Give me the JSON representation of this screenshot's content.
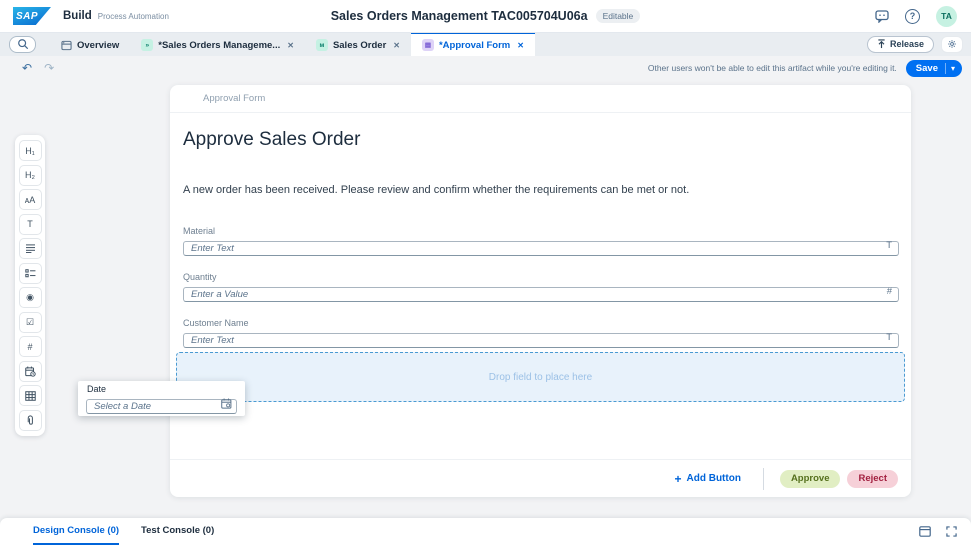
{
  "header": {
    "logo": "SAP",
    "product": "Build",
    "product_tagline": "Process Automation",
    "title": "Sales Orders Management TAC005704U06a",
    "editable_badge": "Editable",
    "help_glyph": "?",
    "avatar": "TA"
  },
  "tab_strip": {
    "tabs": [
      {
        "label": "Overview"
      },
      {
        "label": "*Sales Orders Manageme...",
        "glyph": "»"
      },
      {
        "label": "Sales Order",
        "glyph": "ᴍ"
      },
      {
        "label": "*Approval Form",
        "glyph": "▤"
      }
    ],
    "release_label": "Release"
  },
  "toolbar": {
    "lock_message": "Other users won't be able to edit this artifact while you're editing it.",
    "save_label": "Save"
  },
  "palette": {
    "glyphs": {
      "heading1": "H₁",
      "heading2": "H₂",
      "font": "ᴀA",
      "text": "T",
      "radio": "◉",
      "checkbox": "☑",
      "number": "#"
    }
  },
  "form": {
    "header_label": "Approval Form",
    "title": "Approve Sales Order",
    "description": "A new order has been received. Please review and confirm whether the requirements can be met or not.",
    "fields": [
      {
        "label": "Material",
        "placeholder": "Enter Text",
        "type_icon": "T"
      },
      {
        "label": "Quantity",
        "placeholder": "Enter a Value",
        "type_icon": "#"
      },
      {
        "label": "Customer Name",
        "placeholder": "Enter Text",
        "type_icon": "T"
      }
    ],
    "dropzone_text": "Drop field to place here",
    "footer": {
      "add_button_label": "Add Button",
      "approve_label": "Approve",
      "reject_label": "Reject"
    }
  },
  "drag_field": {
    "label": "Date",
    "placeholder": "Select a Date"
  },
  "console": {
    "design_tab": "Design Console (0)",
    "test_tab": "Test Console (0)"
  },
  "icons": {
    "close": "✕",
    "undo": "↶",
    "redo": "↷",
    "chevron_down": "▾",
    "plus": "+"
  },
  "colors": {
    "accent_blue": "#0064d9",
    "save_blue": "#0070f2",
    "approve_bg": "#e1eec3",
    "approve_text": "#55701d",
    "reject_bg": "#f6d0d8",
    "reject_text": "#a21f3f"
  }
}
